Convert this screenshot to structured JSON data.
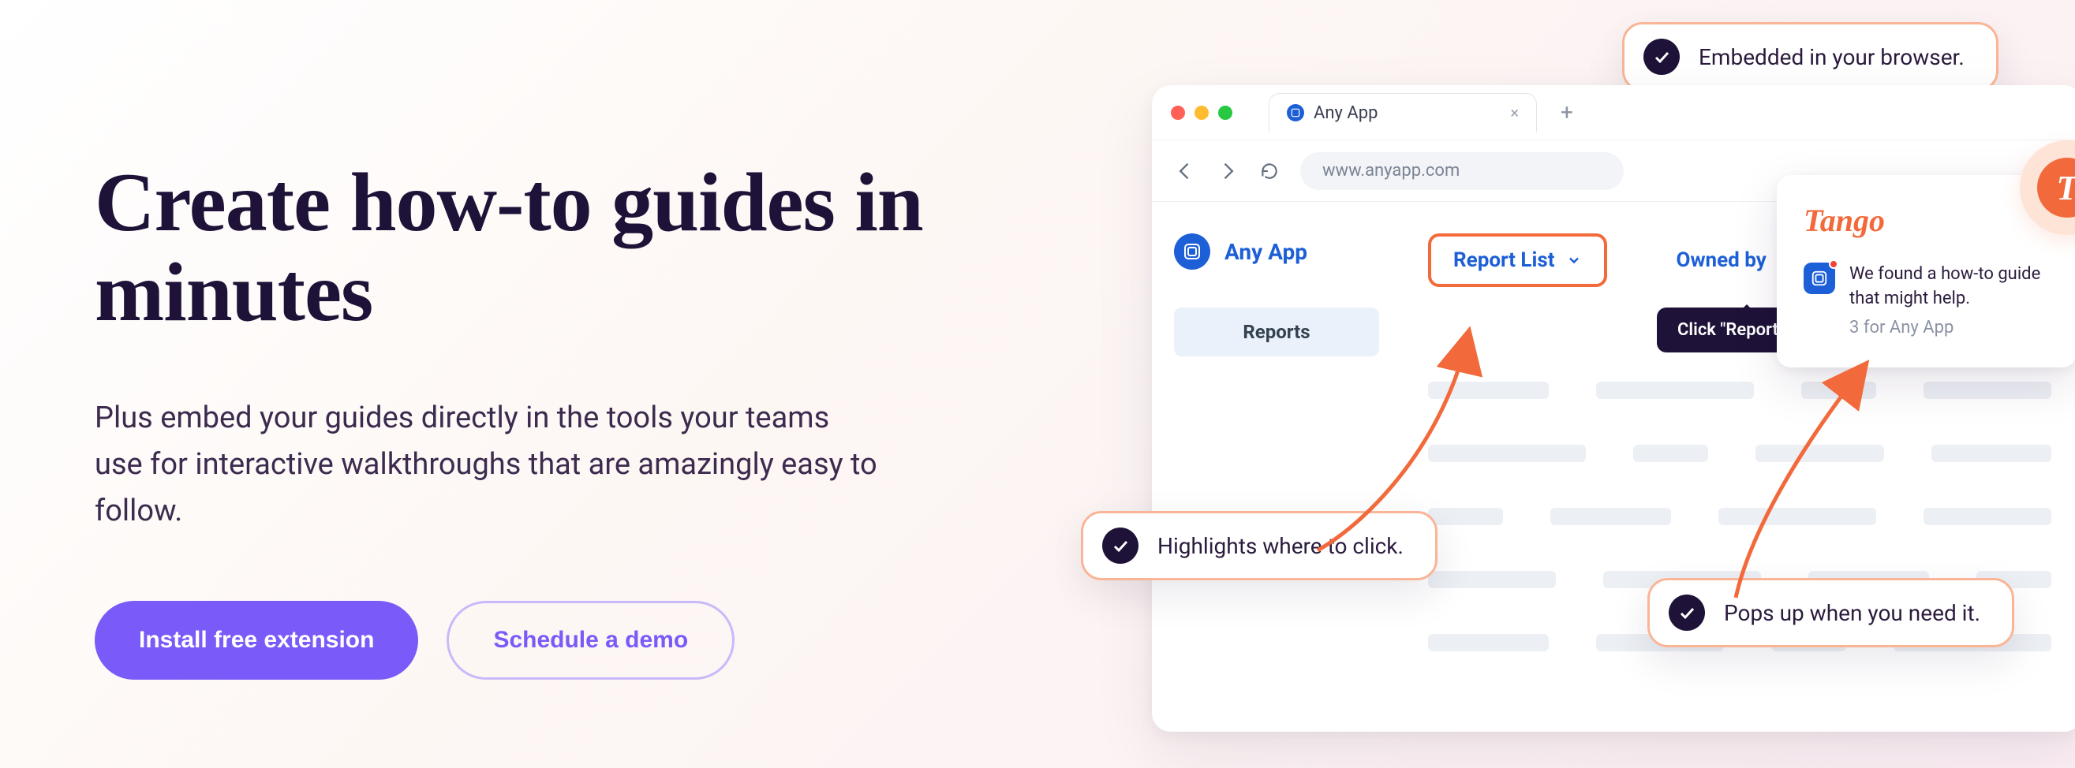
{
  "hero": {
    "title": "Create how-to guides in minutes",
    "subtitle": "Plus embed your guides directly in the tools your teams use for interactive walkthroughs that are amazingly easy to follow.",
    "primary_cta": "Install free extension",
    "secondary_cta": "Schedule a demo"
  },
  "browser": {
    "tab_label": "Any App",
    "url": "www.anyapp.com"
  },
  "app": {
    "brand": "Any App",
    "sidebar_item": "Reports",
    "filter_report_list": "Report List",
    "filter_owned_by": "Owned by",
    "tooltip": "Click \"Report List\""
  },
  "tango": {
    "logo": "Tango",
    "message": "We found a how-to guide that might help.",
    "sub": "3 for Any App",
    "fab_letter": "T"
  },
  "callouts": {
    "embedded": "Embedded in your browser.",
    "highlights": "Highlights where to click.",
    "pops": "Pops up when you need it."
  }
}
